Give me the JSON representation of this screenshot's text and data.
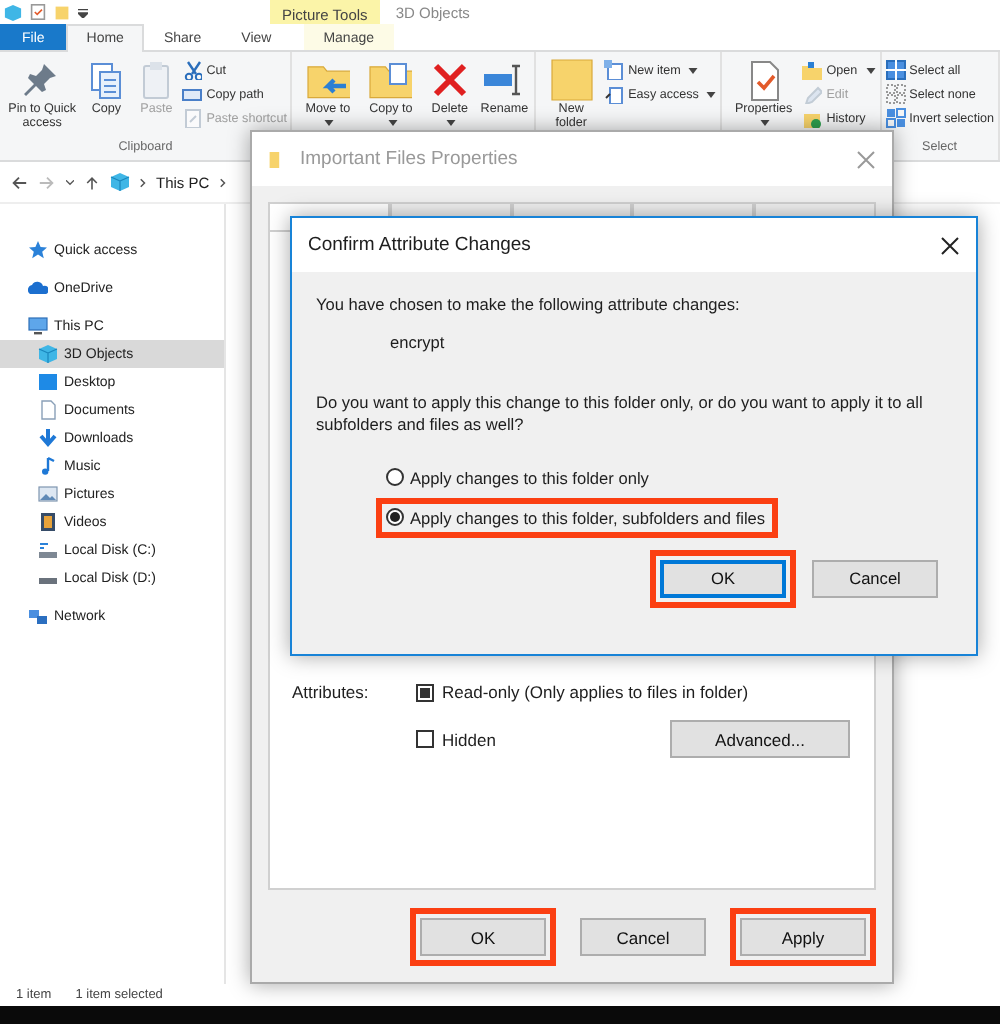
{
  "explorer": {
    "context_tab_group": "Picture Tools",
    "title": "3D Objects",
    "ribbon_tabs": [
      {
        "label": "File",
        "selected": false,
        "kind": "file"
      },
      {
        "label": "Home",
        "selected": true,
        "kind": "tab"
      },
      {
        "label": "Share",
        "selected": false,
        "kind": "tab"
      },
      {
        "label": "View",
        "selected": false,
        "kind": "tab"
      },
      {
        "label": "Manage",
        "selected": false,
        "kind": "context"
      }
    ],
    "ribbon_groups": [
      {
        "label": "Clipboard",
        "large": [
          {
            "label": "Pin to Quick access",
            "disabled": false,
            "dropdown": false
          },
          {
            "label": "Copy",
            "disabled": false,
            "dropdown": false
          },
          {
            "label": "Paste",
            "disabled": true,
            "dropdown": false
          }
        ],
        "small": [
          {
            "label": "Cut",
            "disabled": false,
            "dropdown": false
          },
          {
            "label": "Copy path",
            "disabled": false,
            "dropdown": false
          },
          {
            "label": "Paste shortcut",
            "disabled": true,
            "dropdown": false
          }
        ]
      },
      {
        "large": [
          {
            "label": "Move to",
            "disabled": false,
            "dropdown": true
          },
          {
            "label": "Copy to",
            "disabled": false,
            "dropdown": true
          },
          {
            "label": "Delete",
            "disabled": false,
            "dropdown": true
          },
          {
            "label": "Rename",
            "disabled": false,
            "dropdown": false
          }
        ]
      },
      {
        "large": [
          {
            "label": "New folder",
            "disabled": false,
            "dropdown": false
          }
        ],
        "small": [
          {
            "label": "New item",
            "disabled": false,
            "dropdown": true
          },
          {
            "label": "Easy access",
            "disabled": false,
            "dropdown": true
          }
        ]
      },
      {
        "large": [
          {
            "label": "Properties",
            "disabled": false,
            "dropdown": true
          }
        ],
        "small": [
          {
            "label": "Open",
            "disabled": false,
            "dropdown": true
          },
          {
            "label": "Edit",
            "disabled": true,
            "dropdown": false
          },
          {
            "label": "History",
            "disabled": false,
            "dropdown": false
          }
        ]
      },
      {
        "label": "Select",
        "small": [
          {
            "label": "Select all",
            "disabled": false,
            "dropdown": false
          },
          {
            "label": "Select none",
            "disabled": false,
            "dropdown": false
          },
          {
            "label": "Invert selection",
            "disabled": false,
            "dropdown": false
          }
        ]
      }
    ],
    "address": [
      "This PC"
    ],
    "sidebar": {
      "items": [
        {
          "label": "Quick access",
          "selected": false
        },
        {
          "label": "OneDrive",
          "selected": false
        },
        {
          "label": "This PC",
          "selected": false,
          "children": [
            {
              "label": "3D Objects",
              "selected": true
            },
            {
              "label": "Desktop",
              "selected": false
            },
            {
              "label": "Documents",
              "selected": false
            },
            {
              "label": "Downloads",
              "selected": false
            },
            {
              "label": "Music",
              "selected": false
            },
            {
              "label": "Pictures",
              "selected": false
            },
            {
              "label": "Videos",
              "selected": false
            },
            {
              "label": "Local Disk (C:)",
              "selected": false
            },
            {
              "label": "Local Disk (D:)",
              "selected": false
            }
          ]
        },
        {
          "label": "Network",
          "selected": false
        }
      ]
    },
    "status_bar": [
      "1 item",
      "1 item selected"
    ]
  },
  "properties_dialog": {
    "title": "Important Files Properties",
    "attributes_label": "Attributes:",
    "attributes": [
      {
        "label": "Read-only (Only applies to files in folder)",
        "checked": true
      },
      {
        "label": "Hidden",
        "checked": false
      }
    ],
    "advanced_button": "Advanced...",
    "buttons": [
      {
        "label": "OK",
        "highlighted": true
      },
      {
        "label": "Cancel",
        "highlighted": false
      },
      {
        "label": "Apply",
        "highlighted": true
      }
    ]
  },
  "confirm_dialog": {
    "title": "Confirm Attribute Changes",
    "intro": "You have chosen to make the following attribute changes:",
    "change": "encrypt",
    "question": "Do you want to apply this change to this folder only, or do you want to apply it to all subfolders and files as well?",
    "options": [
      {
        "label": "Apply changes to this folder only",
        "selected": false,
        "highlighted": false
      },
      {
        "label": "Apply changes to this folder, subfolders and files",
        "selected": true,
        "highlighted": true
      }
    ],
    "buttons": [
      {
        "label": "OK",
        "default": true,
        "highlighted": true
      },
      {
        "label": "Cancel",
        "default": false,
        "highlighted": false
      }
    ]
  }
}
